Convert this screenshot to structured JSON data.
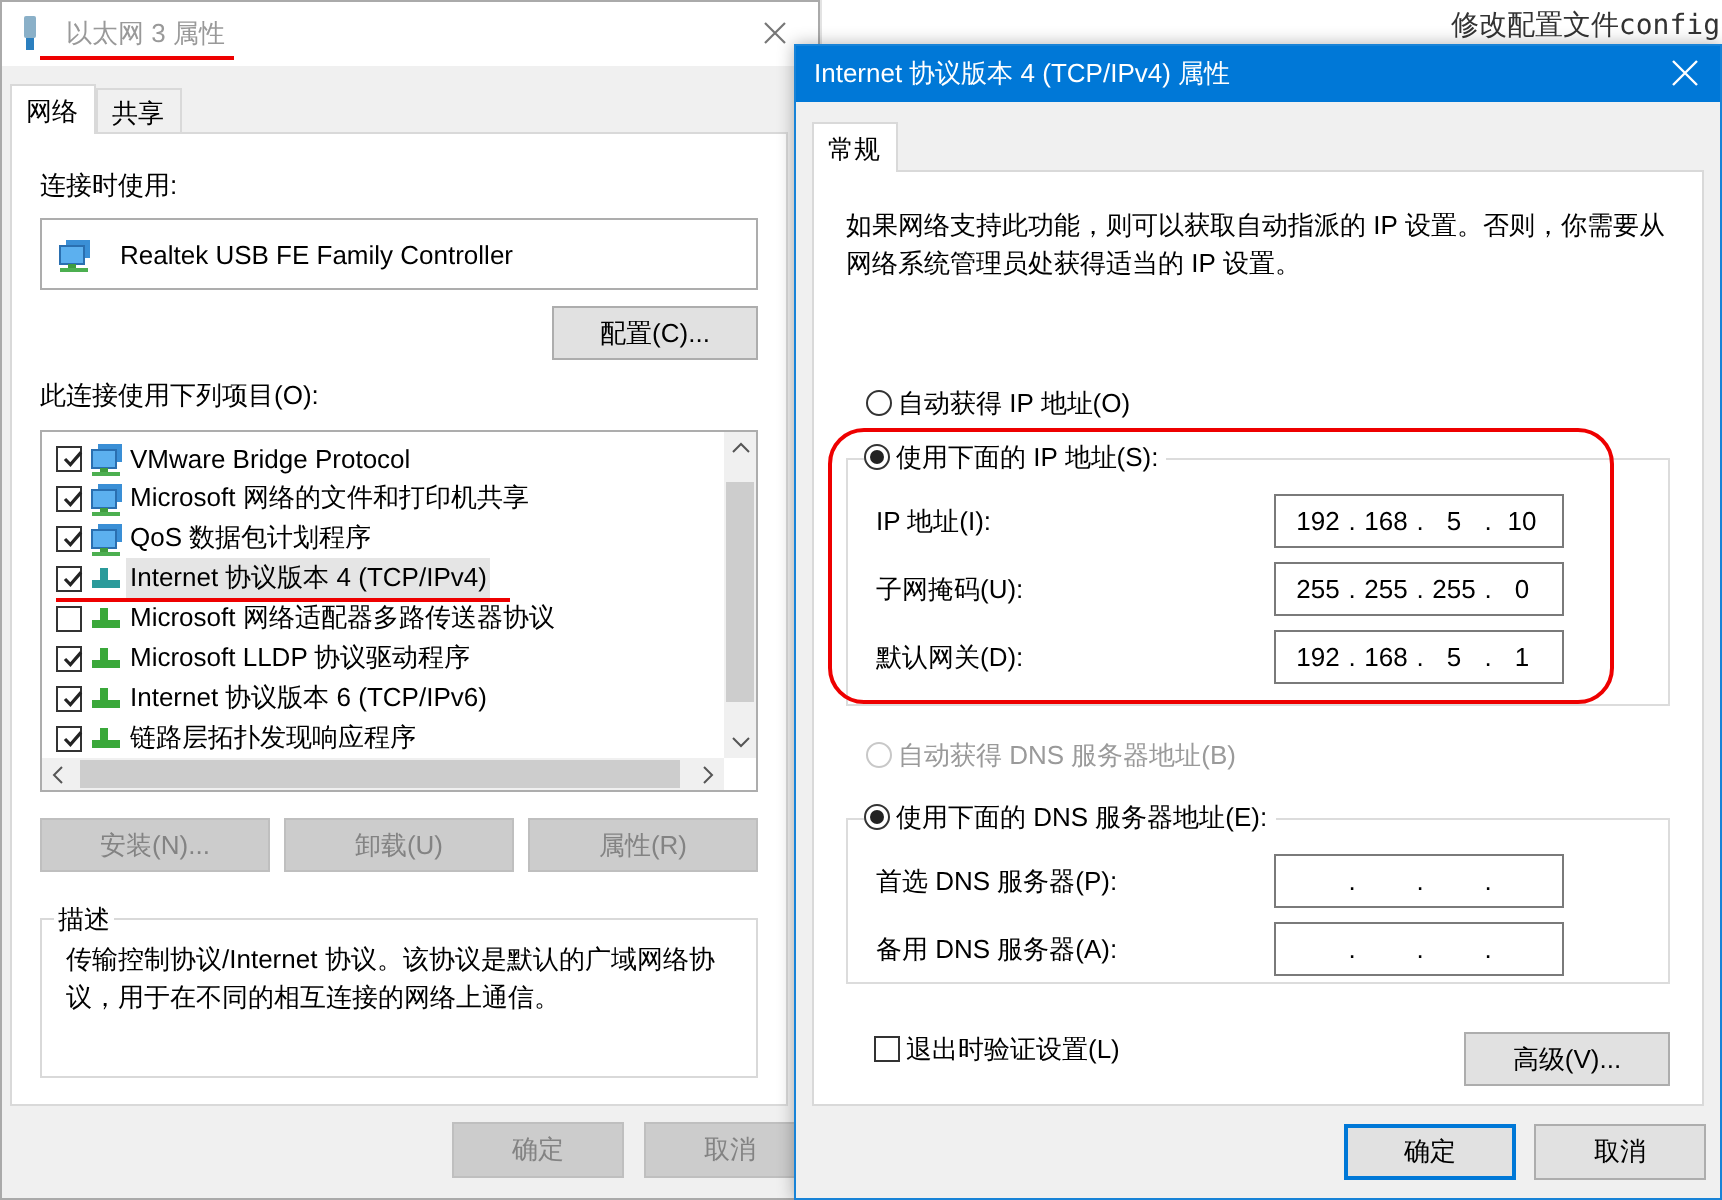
{
  "background": {
    "text": "修改配置文件config"
  },
  "adapter_dialog": {
    "title": "以太网 3 属性",
    "title_marked": true,
    "tabs": [
      {
        "label": "网络",
        "selected": true
      },
      {
        "label": "共享",
        "selected": false
      }
    ],
    "connect_using_label": "连接时使用:",
    "adapter": {
      "name": "Realtek USB FE Family Controller"
    },
    "configure_button": "配置(C)...",
    "items_label": "此连接使用下列项目(O):",
    "items": [
      {
        "label": "VMware Bridge Protocol",
        "kind": "service",
        "checked": true,
        "selected": false,
        "marked": false
      },
      {
        "label": "Microsoft 网络的文件和打印机共享",
        "kind": "service",
        "checked": true,
        "selected": false,
        "marked": false
      },
      {
        "label": "QoS 数据包计划程序",
        "kind": "service",
        "checked": true,
        "selected": false,
        "marked": false
      },
      {
        "label": "Internet 协议版本 4 (TCP/IPv4)",
        "kind": "protocol",
        "checked": true,
        "selected": true,
        "marked": true
      },
      {
        "label": "Microsoft 网络适配器多路传送器协议",
        "kind": "protocol",
        "checked": false,
        "selected": false,
        "marked": false
      },
      {
        "label": "Microsoft LLDP 协议驱动程序",
        "kind": "protocol",
        "checked": true,
        "selected": false,
        "marked": false
      },
      {
        "label": "Internet 协议版本 6 (TCP/IPv6)",
        "kind": "protocol",
        "checked": true,
        "selected": false,
        "marked": false
      },
      {
        "label": "链路层拓扑发现响应程序",
        "kind": "protocol",
        "checked": true,
        "selected": false,
        "marked": false
      }
    ],
    "item_buttons": [
      {
        "label": "安装(N)...",
        "disabled": true
      },
      {
        "label": "卸载(U)",
        "disabled": true
      },
      {
        "label": "属性(R)",
        "disabled": true
      }
    ],
    "description": {
      "legend": "描述",
      "text": "传输控制协议/Internet 协议。该协议是默认的广域网络协议，用于在不同的相互连接的网络上通信。"
    },
    "footer_buttons": [
      {
        "label": "确定",
        "disabled": true
      },
      {
        "label": "取消",
        "disabled": true
      }
    ]
  },
  "ipv4_dialog": {
    "title": "Internet 协议版本 4 (TCP/IPv4) 属性",
    "tabs": [
      {
        "label": "常规",
        "selected": true
      }
    ],
    "intro": "如果网络支持此功能，则可以获取自动指派的 IP 设置。否则，你需要从网络系统管理员处获得适当的 IP 设置。",
    "ip_auto": {
      "label": "自动获得 IP 地址(O)",
      "selected": false,
      "disabled": false
    },
    "ip_group": {
      "label": "使用下面的 IP 地址(S):",
      "selected": true,
      "marked": true,
      "fields": [
        {
          "label": "IP 地址(I):",
          "octets": [
            "192",
            "168",
            "5",
            "10"
          ],
          "separators": [
            ".",
            ".",
            "."
          ]
        },
        {
          "label": "子网掩码(U):",
          "octets": [
            "255",
            "255",
            "255",
            "0"
          ],
          "separators": [
            ".",
            ".",
            "."
          ]
        },
        {
          "label": "默认网关(D):",
          "octets": [
            "192",
            "168",
            "5",
            "1"
          ],
          "separators": [
            ".",
            ".",
            "."
          ]
        }
      ]
    },
    "dns_auto": {
      "label": "自动获得 DNS 服务器地址(B)",
      "selected": false,
      "disabled": true
    },
    "dns_group": {
      "label": "使用下面的 DNS 服务器地址(E):",
      "selected": true,
      "fields": [
        {
          "label": "首选 DNS 服务器(P):",
          "separators": [
            ".",
            ".",
            "."
          ]
        },
        {
          "label": "备用 DNS 服务器(A):",
          "separators": [
            ".",
            ".",
            "."
          ]
        }
      ]
    },
    "validate": {
      "label": "退出时验证设置(L)",
      "checked": false
    },
    "advanced_button": "高级(V)...",
    "footer_buttons": [
      {
        "label": "确定",
        "default": true
      },
      {
        "label": "取消",
        "default": false
      }
    ]
  }
}
